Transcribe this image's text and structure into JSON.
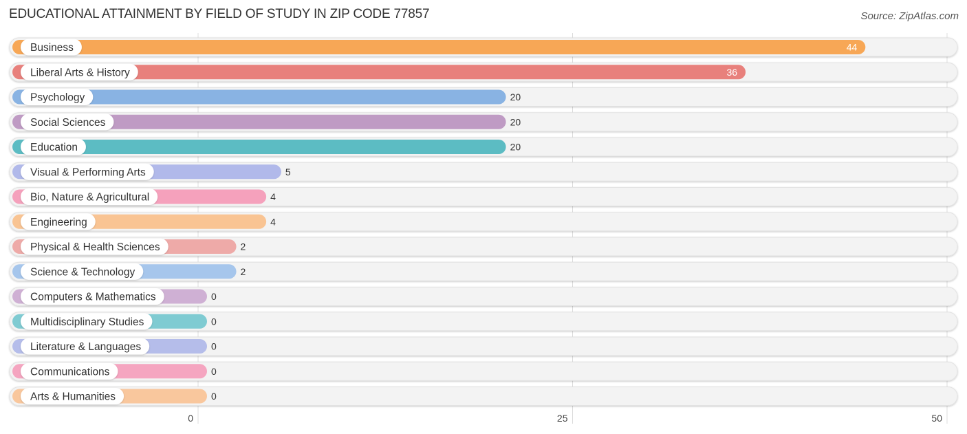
{
  "header": {
    "title": "EDUCATIONAL ATTAINMENT BY FIELD OF STUDY IN ZIP CODE 77857",
    "source": "Source: ZipAtlas.com"
  },
  "chart_data": {
    "type": "bar",
    "orientation": "horizontal",
    "title": "EDUCATIONAL ATTAINMENT BY FIELD OF STUDY IN ZIP CODE 77857",
    "source": "Source: ZipAtlas.com",
    "xlabel": "",
    "ylabel": "",
    "xlim": [
      0,
      50
    ],
    "x_ticks": [
      0,
      25,
      50
    ],
    "x_tick_labels": [
      "0",
      "25",
      "50"
    ],
    "grid": true,
    "categories": [
      "Business",
      "Liberal Arts & History",
      "Psychology",
      "Social Sciences",
      "Education",
      "Visual & Performing Arts",
      "Bio, Nature & Agricultural",
      "Engineering",
      "Physical & Health Sciences",
      "Science & Technology",
      "Computers & Mathematics",
      "Multidisciplinary Studies",
      "Literature & Languages",
      "Communications",
      "Arts & Humanities"
    ],
    "values": [
      44,
      36,
      20,
      20,
      20,
      5,
      4,
      4,
      2,
      2,
      0,
      0,
      0,
      0,
      0
    ],
    "value_labels": [
      "44",
      "36",
      "20",
      "20",
      "20",
      "5",
      "4",
      "4",
      "2",
      "2",
      "0",
      "0",
      "0",
      "0",
      "0"
    ],
    "colors": [
      "#f7a756",
      "#e8807c",
      "#89b3e3",
      "#bf9bc4",
      "#5cbcc3",
      "#b1b9ea",
      "#f5a1bc",
      "#f9c493",
      "#eeaaa8",
      "#a6c6ec",
      "#cfb0d4",
      "#7fcbd2",
      "#b5bdea",
      "#f5a5c0",
      "#f9c79d"
    ]
  }
}
